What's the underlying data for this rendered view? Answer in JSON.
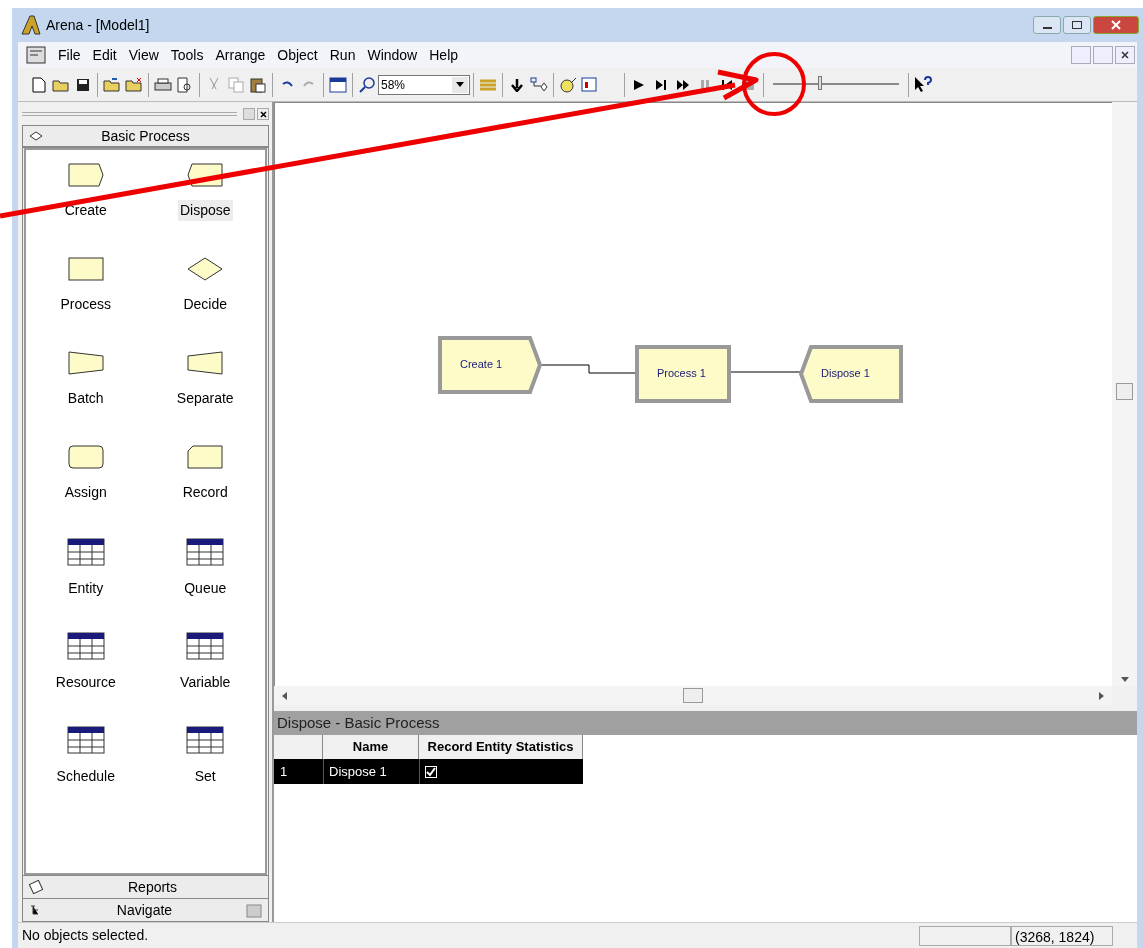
{
  "window": {
    "title": "Arena - [Model1]"
  },
  "menu": [
    "File",
    "Edit",
    "View",
    "Tools",
    "Arrange",
    "Object",
    "Run",
    "Window",
    "Help"
  ],
  "toolbar": {
    "zoom": "58%",
    "speed_slider": {
      "level": 0.37
    }
  },
  "panel": {
    "title": "Basic Process",
    "modules": [
      {
        "label": "Create",
        "kind": "create",
        "selected": false
      },
      {
        "label": "Dispose",
        "kind": "dispose",
        "selected": true
      },
      {
        "label": "Process",
        "kind": "process",
        "selected": false
      },
      {
        "label": "Decide",
        "kind": "decide",
        "selected": false
      },
      {
        "label": "Batch",
        "kind": "batch",
        "selected": false
      },
      {
        "label": "Separate",
        "kind": "separate",
        "selected": false
      },
      {
        "label": "Assign",
        "kind": "assign",
        "selected": false
      },
      {
        "label": "Record",
        "kind": "record",
        "selected": false
      },
      {
        "label": "Entity",
        "kind": "table",
        "selected": false
      },
      {
        "label": "Queue",
        "kind": "table",
        "selected": false
      },
      {
        "label": "Resource",
        "kind": "table",
        "selected": false
      },
      {
        "label": "Variable",
        "kind": "table",
        "selected": false
      },
      {
        "label": "Schedule",
        "kind": "table",
        "selected": false
      },
      {
        "label": "Set",
        "kind": "table",
        "selected": false
      }
    ],
    "bars": [
      {
        "label": "Reports",
        "kind": "reports"
      },
      {
        "label": "Navigate",
        "kind": "navigate"
      }
    ]
  },
  "canvas": {
    "nodes": [
      {
        "label": "Create 1",
        "kind": "create"
      },
      {
        "label": "Process 1",
        "kind": "process"
      },
      {
        "label": "Dispose 1",
        "kind": "dispose"
      }
    ]
  },
  "spreadsheet": {
    "title": "Dispose - Basic Process",
    "columns": [
      "Name",
      "Record Entity Statistics"
    ],
    "rows": [
      {
        "index": "1",
        "name": "Dispose 1",
        "record_entity_statistics": true
      }
    ]
  },
  "status_bar": {
    "message": "No objects selected.",
    "coordinates": "(3268, 1824)"
  }
}
